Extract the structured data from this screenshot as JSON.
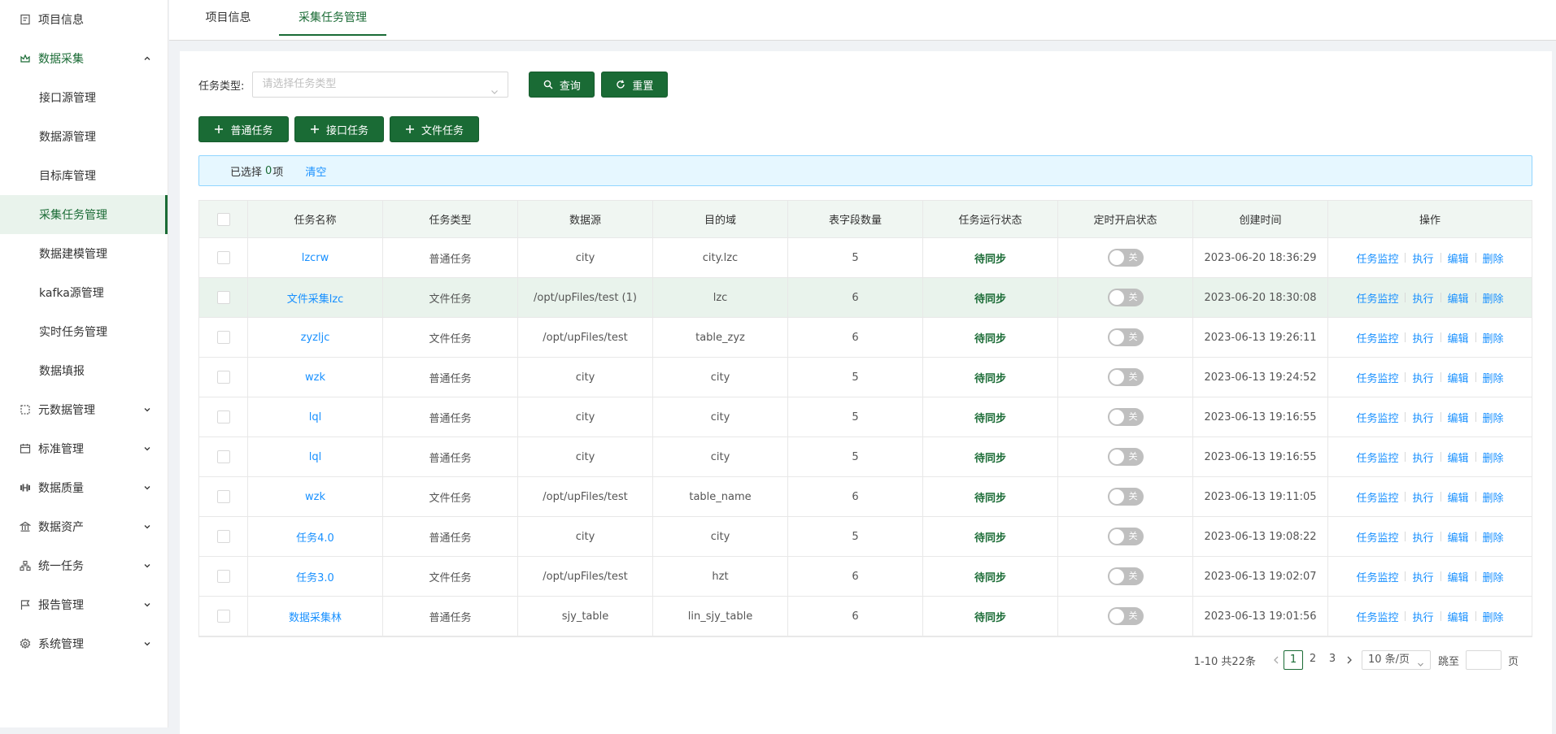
{
  "sidebar": {
    "items": [
      {
        "label": "项目信息",
        "icon": "clipboard-icon"
      },
      {
        "label": "数据采集",
        "icon": "crown-icon"
      },
      {
        "label": "接口源管理"
      },
      {
        "label": "数据源管理"
      },
      {
        "label": "目标库管理"
      },
      {
        "label": "采集任务管理"
      },
      {
        "label": "数据建模管理"
      },
      {
        "label": "kafka源管理"
      },
      {
        "label": "实时任务管理"
      },
      {
        "label": "数据填报"
      },
      {
        "label": "元数据管理",
        "icon": "dashed-square-icon"
      },
      {
        "label": "标准管理",
        "icon": "calendar-icon"
      },
      {
        "label": "数据质量",
        "icon": "dumbbell-icon"
      },
      {
        "label": "数据资产",
        "icon": "bank-icon"
      },
      {
        "label": "统一任务",
        "icon": "org-chart-icon"
      },
      {
        "label": "报告管理",
        "icon": "flag-icon"
      },
      {
        "label": "系统管理",
        "icon": "gear-icon"
      }
    ]
  },
  "tabs": [
    {
      "label": "项目信息"
    },
    {
      "label": "采集任务管理"
    }
  ],
  "filter": {
    "label": "任务类型:",
    "placeholder": "请选择任务类型",
    "query_label": "查询",
    "reset_label": "重置"
  },
  "actions": {
    "add_normal": "普通任务",
    "add_api": "接口任务",
    "add_file": "文件任务"
  },
  "alert": {
    "prefix": "已选择",
    "count": "0",
    "suffix": "项",
    "clear": "清空"
  },
  "table": {
    "columns": [
      "任务名称",
      "任务类型",
      "数据源",
      "目的域",
      "表字段数量",
      "任务运行状态",
      "定时开启状态",
      "创建时间",
      "操作"
    ],
    "switch_off_label": "关",
    "ops": [
      "任务监控",
      "执行",
      "编辑",
      "删除"
    ],
    "rows": [
      {
        "name": "lzcrw",
        "type": "普通任务",
        "source": "city",
        "target": "city.lzc",
        "fields": "5",
        "status": "待同步",
        "created": "2023-06-20 18:36:29"
      },
      {
        "name": "文件采集lzc",
        "type": "文件任务",
        "source": "/opt/upFiles/test (1)",
        "target": "lzc",
        "fields": "6",
        "status": "待同步",
        "created": "2023-06-20 18:30:08"
      },
      {
        "name": "zyzljc",
        "type": "文件任务",
        "source": "/opt/upFiles/test",
        "target": "table_zyz",
        "fields": "6",
        "status": "待同步",
        "created": "2023-06-13 19:26:11"
      },
      {
        "name": "wzk",
        "type": "普通任务",
        "source": "city",
        "target": "city",
        "fields": "5",
        "status": "待同步",
        "created": "2023-06-13 19:24:52"
      },
      {
        "name": "lql",
        "type": "普通任务",
        "source": "city",
        "target": "city",
        "fields": "5",
        "status": "待同步",
        "created": "2023-06-13 19:16:55"
      },
      {
        "name": "lql",
        "type": "普通任务",
        "source": "city",
        "target": "city",
        "fields": "5",
        "status": "待同步",
        "created": "2023-06-13 19:16:55"
      },
      {
        "name": "wzk",
        "type": "文件任务",
        "source": "/opt/upFiles/test",
        "target": "table_name",
        "fields": "6",
        "status": "待同步",
        "created": "2023-06-13 19:11:05"
      },
      {
        "name": "任务4.0",
        "type": "普通任务",
        "source": "city",
        "target": "city",
        "fields": "5",
        "status": "待同步",
        "created": "2023-06-13 19:08:22"
      },
      {
        "name": "任务3.0",
        "type": "文件任务",
        "source": "/opt/upFiles/test",
        "target": "hzt",
        "fields": "6",
        "status": "待同步",
        "created": "2023-06-13 19:02:07"
      },
      {
        "name": "数据采集林",
        "type": "普通任务",
        "source": "sjy_table",
        "target": "lin_sjy_table",
        "fields": "6",
        "status": "待同步",
        "created": "2023-06-13 19:01:56"
      }
    ]
  },
  "pagination": {
    "total_text": "1-10 共22条",
    "pages": [
      "1",
      "2",
      "3"
    ],
    "current": "1",
    "page_size": "10 条/页",
    "jump_label": "跳至",
    "page_unit": "页"
  },
  "colors": {
    "primary": "#1a6b35",
    "link": "#1890ff",
    "row_highlight": "#e9f3ec",
    "alert_bg": "#e6f7ff"
  }
}
